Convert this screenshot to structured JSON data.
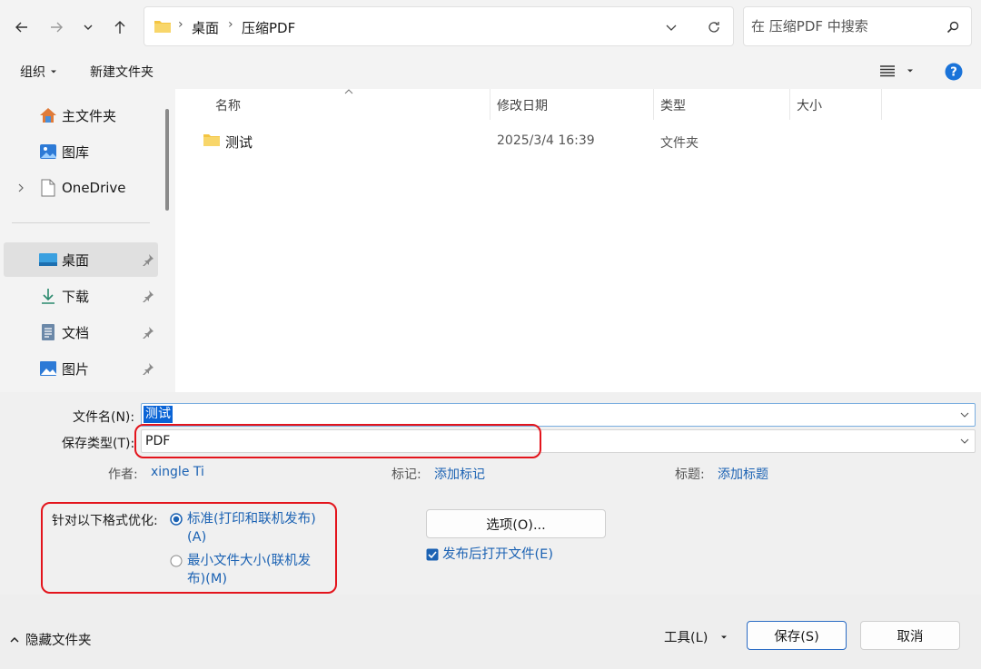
{
  "nav": {
    "path": [
      "桌面",
      "压缩PDF"
    ],
    "search_placeholder": "在 压缩PDF 中搜索"
  },
  "commands": {
    "organize": "组织",
    "new_folder": "新建文件夹"
  },
  "sidebar": {
    "items": [
      {
        "label": "主文件夹",
        "icon": "home-icon"
      },
      {
        "label": "图库",
        "icon": "gallery-icon"
      },
      {
        "label": "OneDrive",
        "icon": "file-icon"
      },
      {
        "label": "桌面",
        "icon": "desktop-icon"
      },
      {
        "label": "下载",
        "icon": "download-icon"
      },
      {
        "label": "文档",
        "icon": "document-icon"
      },
      {
        "label": "图片",
        "icon": "picture-icon"
      }
    ]
  },
  "file_list": {
    "columns": [
      "名称",
      "修改日期",
      "类型",
      "大小"
    ],
    "rows": [
      {
        "name": "测试",
        "modified": "2025/3/4 16:39",
        "type": "文件夹",
        "size": ""
      }
    ]
  },
  "form": {
    "filename_label": "文件名(N):",
    "filename_value": "测试",
    "savetype_label": "保存类型(T):",
    "savetype_value": "PDF",
    "author_label": "作者:",
    "author_value": "xingle Ti",
    "tags_label": "标记:",
    "tags_value": "添加标记",
    "title_label": "标题:",
    "title_value": "添加标题",
    "optimize_label": "针对以下格式优化:",
    "opt_standard_line1": "标准(打印和联机发布)",
    "opt_standard_line2": "(A)",
    "opt_min_line1": "最小文件大小(联机发",
    "opt_min_line2": "布)(M)",
    "options_button": "选项(O)...",
    "open_after_label": "发布后打开文件(E)"
  },
  "footer": {
    "hide_folders": "隐藏文件夹",
    "tools": "工具(L)",
    "save": "保存(S)",
    "cancel": "取消"
  },
  "colors": {
    "accent": "#1b62b3",
    "highlight": "#e3141c",
    "folder": "#f4c542"
  }
}
